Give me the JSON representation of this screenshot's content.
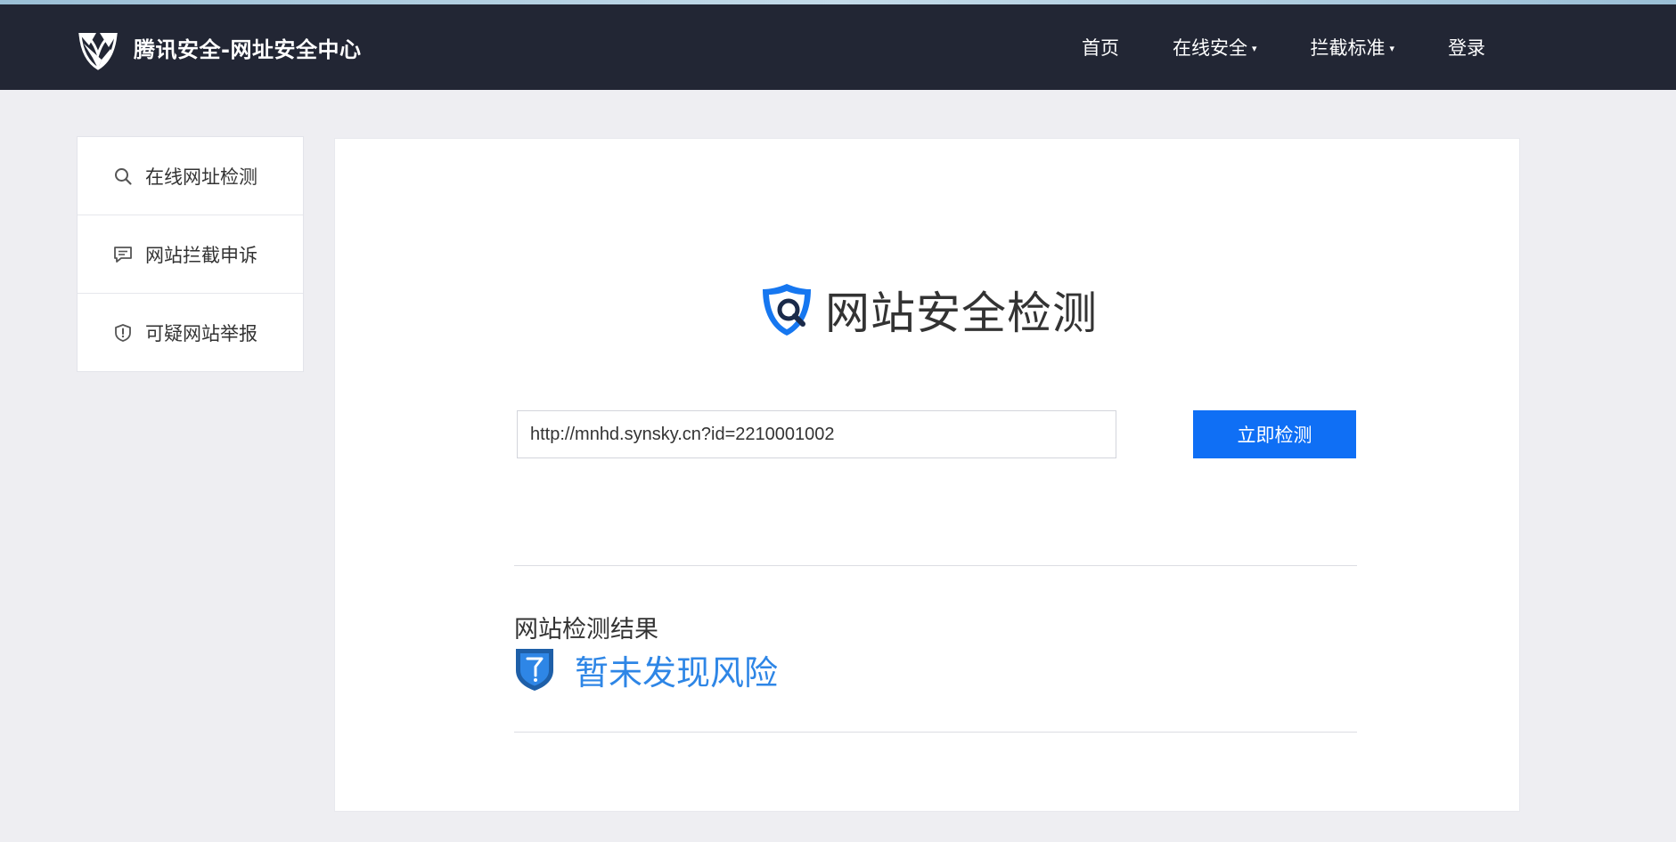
{
  "header": {
    "brand_title": "腾讯安全-网址安全中心",
    "logo_icon": "tencent-security-logo-icon",
    "nav": [
      {
        "label": "首页",
        "dropdown": false
      },
      {
        "label": "在线安全",
        "dropdown": true
      },
      {
        "label": "拦截标准",
        "dropdown": true
      },
      {
        "label": "登录",
        "dropdown": false
      }
    ],
    "caret": "▾"
  },
  "sidebar": {
    "items": [
      {
        "label": "在线网址检测",
        "icon": "search-icon"
      },
      {
        "label": "网站拦截申诉",
        "icon": "chat-bubble-icon"
      },
      {
        "label": "可疑网站举报",
        "icon": "shield-alert-icon"
      }
    ]
  },
  "main": {
    "hero_title": "网站安全检测",
    "hero_icon": "shield-search-icon",
    "url_value": "http://mnhd.synsky.cn?id=2210001002",
    "check_button": "立即检测",
    "result_label": "网站检测结果",
    "result_status": "暂未发现风险",
    "result_icon": "unknown-shield-icon"
  },
  "colors": {
    "header_bg": "#222634",
    "page_bg": "#eeeef2",
    "accent": "#0f6ff5",
    "status_blue": "#2e86e6"
  }
}
